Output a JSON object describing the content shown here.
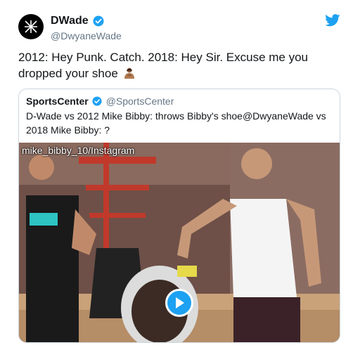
{
  "author": {
    "display_name": "DWade",
    "handle": "@DwyaneWade",
    "avatar_icon": "wade-logo-icon",
    "verified_icon": "verified-badge-icon"
  },
  "tweet": {
    "text": "2012: Hey Punk. Catch. 2018: Hey Sir. Excuse me you dropped your shoe",
    "emoji_icon": "person-bowing-emoji-icon"
  },
  "brand": {
    "icon": "twitter-bird-icon",
    "color": "#1da1f2"
  },
  "quoted_tweet": {
    "display_name": "SportsCenter",
    "handle": "@SportsCenter",
    "text": "D-Wade vs 2012 Mike Bibby: throws Bibby's shoe@DwyaneWade vs 2018 Mike Bibby: ?",
    "media": {
      "watermark": "mike_bibby_10/Instagram",
      "play_icon": "play-icon"
    }
  },
  "colors": {
    "text": "#14171a",
    "secondary": "#657786",
    "border": "#ccd6dd",
    "accent": "#1da1f2"
  }
}
